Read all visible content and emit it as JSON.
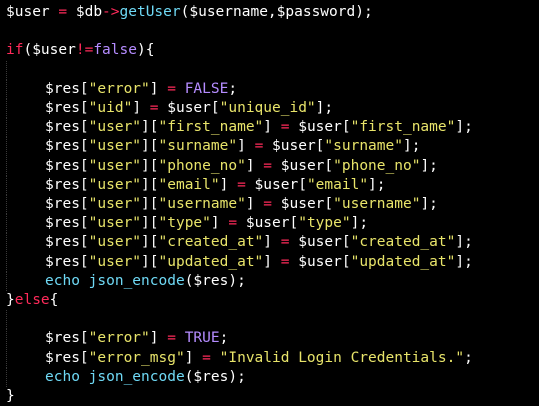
{
  "colors": {
    "background": "#000000",
    "plain": "#ffffff",
    "keyword": "#ff2a5a",
    "function": "#6fd9f5",
    "string": "#e8e46a",
    "constant": "#b58cff"
  },
  "lines": [
    {
      "indent": false,
      "tokens": [
        {
          "t": "$user ",
          "k": "plain"
        },
        {
          "t": "=",
          "k": "op"
        },
        {
          "t": " $db",
          "k": "plain"
        },
        {
          "t": "->",
          "k": "op"
        },
        {
          "t": "getUser",
          "k": "fn"
        },
        {
          "t": "($username,$password);",
          "k": "plain"
        }
      ]
    },
    {
      "indent": false,
      "tokens": []
    },
    {
      "indent": false,
      "tokens": [
        {
          "t": "if",
          "k": "kw"
        },
        {
          "t": "($user",
          "k": "plain"
        },
        {
          "t": "!=",
          "k": "op"
        },
        {
          "t": "false",
          "k": "const"
        },
        {
          "t": "){",
          "k": "plain"
        }
      ]
    },
    {
      "indent": true,
      "tokens": []
    },
    {
      "indent": true,
      "tokens": [
        {
          "t": "$res[",
          "k": "plain"
        },
        {
          "t": "\"error\"",
          "k": "str"
        },
        {
          "t": "] ",
          "k": "plain"
        },
        {
          "t": "=",
          "k": "op"
        },
        {
          "t": " ",
          "k": "plain"
        },
        {
          "t": "FALSE",
          "k": "const"
        },
        {
          "t": ";",
          "k": "plain"
        }
      ]
    },
    {
      "indent": true,
      "tokens": [
        {
          "t": "$res[",
          "k": "plain"
        },
        {
          "t": "\"uid\"",
          "k": "str"
        },
        {
          "t": "] ",
          "k": "plain"
        },
        {
          "t": "=",
          "k": "op"
        },
        {
          "t": " $user[",
          "k": "plain"
        },
        {
          "t": "\"unique_id\"",
          "k": "str"
        },
        {
          "t": "];",
          "k": "plain"
        }
      ]
    },
    {
      "indent": true,
      "tokens": [
        {
          "t": "$res[",
          "k": "plain"
        },
        {
          "t": "\"user\"",
          "k": "str"
        },
        {
          "t": "][",
          "k": "plain"
        },
        {
          "t": "\"first_name\"",
          "k": "str"
        },
        {
          "t": "] ",
          "k": "plain"
        },
        {
          "t": "=",
          "k": "op"
        },
        {
          "t": " $user[",
          "k": "plain"
        },
        {
          "t": "\"first_name\"",
          "k": "str"
        },
        {
          "t": "];",
          "k": "plain"
        }
      ]
    },
    {
      "indent": true,
      "tokens": [
        {
          "t": "$res[",
          "k": "plain"
        },
        {
          "t": "\"user\"",
          "k": "str"
        },
        {
          "t": "][",
          "k": "plain"
        },
        {
          "t": "\"surname\"",
          "k": "str"
        },
        {
          "t": "] ",
          "k": "plain"
        },
        {
          "t": "=",
          "k": "op"
        },
        {
          "t": " $user[",
          "k": "plain"
        },
        {
          "t": "\"surname\"",
          "k": "str"
        },
        {
          "t": "];",
          "k": "plain"
        }
      ]
    },
    {
      "indent": true,
      "tokens": [
        {
          "t": "$res[",
          "k": "plain"
        },
        {
          "t": "\"user\"",
          "k": "str"
        },
        {
          "t": "][",
          "k": "plain"
        },
        {
          "t": "\"phone_no\"",
          "k": "str"
        },
        {
          "t": "] ",
          "k": "plain"
        },
        {
          "t": "=",
          "k": "op"
        },
        {
          "t": " $user[",
          "k": "plain"
        },
        {
          "t": "\"phone_no\"",
          "k": "str"
        },
        {
          "t": "];",
          "k": "plain"
        }
      ]
    },
    {
      "indent": true,
      "tokens": [
        {
          "t": "$res[",
          "k": "plain"
        },
        {
          "t": "\"user\"",
          "k": "str"
        },
        {
          "t": "][",
          "k": "plain"
        },
        {
          "t": "\"email\"",
          "k": "str"
        },
        {
          "t": "] ",
          "k": "plain"
        },
        {
          "t": "=",
          "k": "op"
        },
        {
          "t": " $user[",
          "k": "plain"
        },
        {
          "t": "\"email\"",
          "k": "str"
        },
        {
          "t": "];",
          "k": "plain"
        }
      ]
    },
    {
      "indent": true,
      "tokens": [
        {
          "t": "$res[",
          "k": "plain"
        },
        {
          "t": "\"user\"",
          "k": "str"
        },
        {
          "t": "][",
          "k": "plain"
        },
        {
          "t": "\"username\"",
          "k": "str"
        },
        {
          "t": "] ",
          "k": "plain"
        },
        {
          "t": "=",
          "k": "op"
        },
        {
          "t": " $user[",
          "k": "plain"
        },
        {
          "t": "\"username\"",
          "k": "str"
        },
        {
          "t": "];",
          "k": "plain"
        }
      ]
    },
    {
      "indent": true,
      "tokens": [
        {
          "t": "$res[",
          "k": "plain"
        },
        {
          "t": "\"user\"",
          "k": "str"
        },
        {
          "t": "][",
          "k": "plain"
        },
        {
          "t": "\"type\"",
          "k": "str"
        },
        {
          "t": "] ",
          "k": "plain"
        },
        {
          "t": "=",
          "k": "op"
        },
        {
          "t": " $user[",
          "k": "plain"
        },
        {
          "t": "\"type\"",
          "k": "str"
        },
        {
          "t": "];",
          "k": "plain"
        }
      ]
    },
    {
      "indent": true,
      "tokens": [
        {
          "t": "$res[",
          "k": "plain"
        },
        {
          "t": "\"user\"",
          "k": "str"
        },
        {
          "t": "][",
          "k": "plain"
        },
        {
          "t": "\"created_at\"",
          "k": "str"
        },
        {
          "t": "] ",
          "k": "plain"
        },
        {
          "t": "=",
          "k": "op"
        },
        {
          "t": " $user[",
          "k": "plain"
        },
        {
          "t": "\"created_at\"",
          "k": "str"
        },
        {
          "t": "];",
          "k": "plain"
        }
      ]
    },
    {
      "indent": true,
      "tokens": [
        {
          "t": "$res[",
          "k": "plain"
        },
        {
          "t": "\"user\"",
          "k": "str"
        },
        {
          "t": "][",
          "k": "plain"
        },
        {
          "t": "\"updated_at\"",
          "k": "str"
        },
        {
          "t": "] ",
          "k": "plain"
        },
        {
          "t": "=",
          "k": "op"
        },
        {
          "t": " $user[",
          "k": "plain"
        },
        {
          "t": "\"updated_at\"",
          "k": "str"
        },
        {
          "t": "];",
          "k": "plain"
        }
      ]
    },
    {
      "indent": true,
      "tokens": [
        {
          "t": "echo",
          "k": "fn"
        },
        {
          "t": " ",
          "k": "plain"
        },
        {
          "t": "json_encode",
          "k": "fn"
        },
        {
          "t": "($res);",
          "k": "plain"
        }
      ]
    },
    {
      "indent": false,
      "tokens": [
        {
          "t": "}",
          "k": "plain"
        },
        {
          "t": "else",
          "k": "kw"
        },
        {
          "t": "{",
          "k": "plain"
        }
      ]
    },
    {
      "indent": true,
      "tokens": []
    },
    {
      "indent": true,
      "tokens": [
        {
          "t": "$res[",
          "k": "plain"
        },
        {
          "t": "\"error\"",
          "k": "str"
        },
        {
          "t": "] ",
          "k": "plain"
        },
        {
          "t": "=",
          "k": "op"
        },
        {
          "t": " ",
          "k": "plain"
        },
        {
          "t": "TRUE",
          "k": "const"
        },
        {
          "t": ";",
          "k": "plain"
        }
      ]
    },
    {
      "indent": true,
      "tokens": [
        {
          "t": "$res[",
          "k": "plain"
        },
        {
          "t": "\"error_msg\"",
          "k": "str"
        },
        {
          "t": "] ",
          "k": "plain"
        },
        {
          "t": "=",
          "k": "op"
        },
        {
          "t": " ",
          "k": "plain"
        },
        {
          "t": "\"Invalid Login Credentials.\"",
          "k": "str"
        },
        {
          "t": ";",
          "k": "plain"
        }
      ]
    },
    {
      "indent": true,
      "tokens": [
        {
          "t": "echo",
          "k": "fn"
        },
        {
          "t": " ",
          "k": "plain"
        },
        {
          "t": "json_encode",
          "k": "fn"
        },
        {
          "t": "($res);",
          "k": "plain"
        }
      ]
    },
    {
      "indent": false,
      "tokens": [
        {
          "t": "}",
          "k": "plain"
        }
      ]
    }
  ]
}
